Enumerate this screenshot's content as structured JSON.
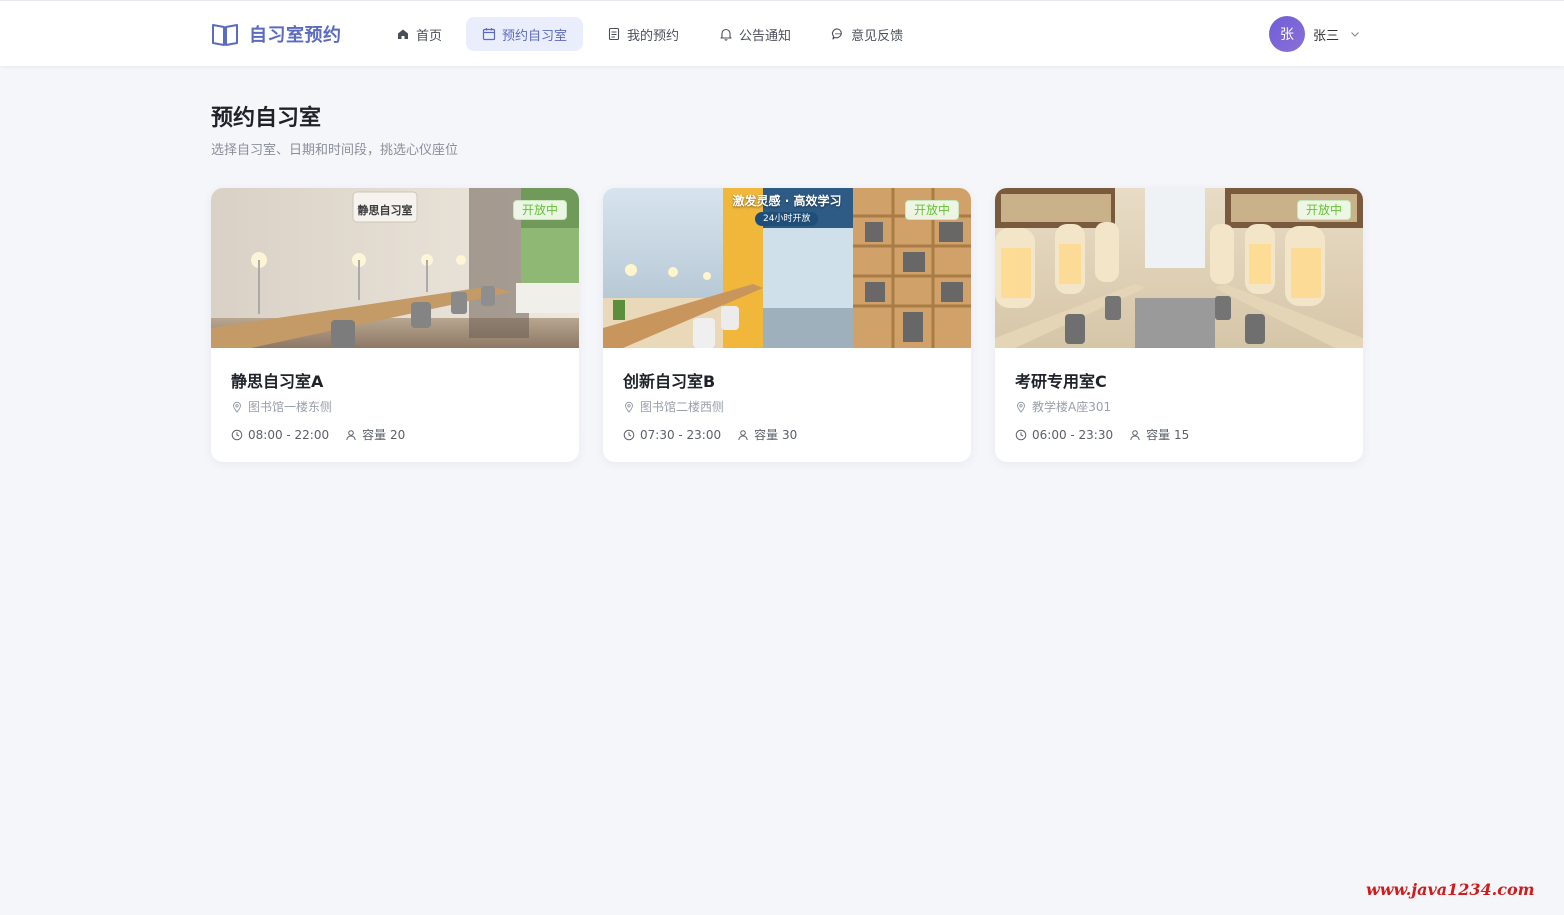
{
  "header": {
    "logo_text": "自习室预约",
    "nav": [
      {
        "label": "首页",
        "icon": "home-icon",
        "active": false
      },
      {
        "label": "预约自习室",
        "icon": "calendar-icon",
        "active": true
      },
      {
        "label": "我的预约",
        "icon": "document-icon",
        "active": false
      },
      {
        "label": "公告通知",
        "icon": "bell-icon",
        "active": false
      },
      {
        "label": "意见反馈",
        "icon": "chat-icon",
        "active": false
      }
    ],
    "user": {
      "avatar_text": "张",
      "name": "张三"
    }
  },
  "main": {
    "title": "预约自习室",
    "subtitle": "选择自习室、日期和时间段，挑选心仪座位",
    "rooms": [
      {
        "name": "静思自习室A",
        "status": "开放中",
        "location": "图书馆一楼东侧",
        "hours": "08:00 - 22:00",
        "capacity": "容量 20",
        "sign_text": "静思自习室"
      },
      {
        "name": "创新自习室B",
        "status": "开放中",
        "location": "图书馆二楼西侧",
        "hours": "07:30 - 23:00",
        "capacity": "容量 30",
        "banner_text": "激发灵感 · 高效学习",
        "banner_pill": "24小时开放"
      },
      {
        "name": "考研专用室C",
        "status": "开放中",
        "location": "教学楼A座301",
        "hours": "06:00 - 23:30",
        "capacity": "容量 15"
      }
    ]
  },
  "watermark": "www.java1234.com",
  "colors": {
    "accent": "#5b6bbf",
    "active_bg": "#eaedfb",
    "status_green": "#67c23a",
    "background": "#f5f6fa"
  }
}
